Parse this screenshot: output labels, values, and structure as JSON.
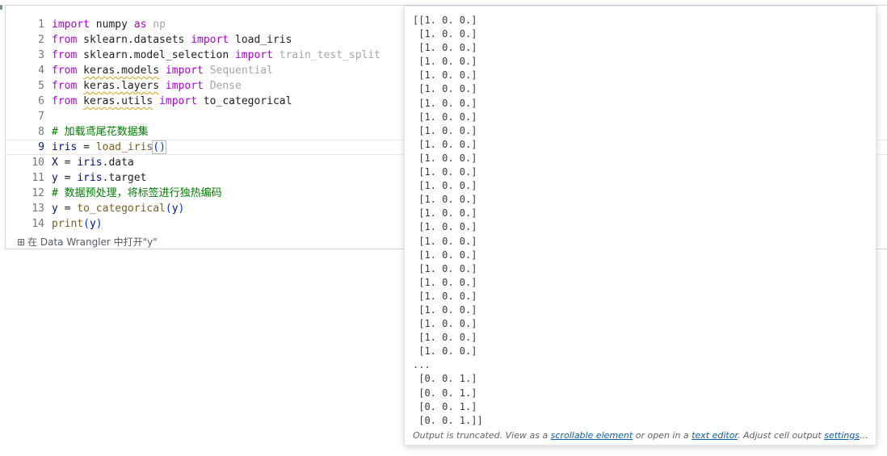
{
  "editor": {
    "lines": [
      {
        "n": "1",
        "parts": [
          {
            "t": "import",
            "c": "kw"
          },
          {
            "t": " numpy ",
            "c": ""
          },
          {
            "t": "as",
            "c": "kw"
          },
          {
            "t": " ",
            "c": ""
          },
          {
            "t": "np",
            "c": "dim"
          }
        ]
      },
      {
        "n": "2",
        "parts": [
          {
            "t": "from",
            "c": "kw"
          },
          {
            "t": " sklearn.datasets ",
            "c": ""
          },
          {
            "t": "import",
            "c": "kw"
          },
          {
            "t": " load_iris",
            "c": ""
          }
        ]
      },
      {
        "n": "3",
        "parts": [
          {
            "t": "from",
            "c": "kw"
          },
          {
            "t": " sklearn.model_selection ",
            "c": ""
          },
          {
            "t": "import",
            "c": "kw"
          },
          {
            "t": " ",
            "c": ""
          },
          {
            "t": "train_test_split",
            "c": "dim"
          }
        ]
      },
      {
        "n": "4",
        "parts": [
          {
            "t": "from",
            "c": "kw"
          },
          {
            "t": " ",
            "c": ""
          },
          {
            "t": "keras.models",
            "c": "sq"
          },
          {
            "t": " ",
            "c": ""
          },
          {
            "t": "import",
            "c": "kw"
          },
          {
            "t": " ",
            "c": ""
          },
          {
            "t": "Sequential",
            "c": "dim"
          }
        ]
      },
      {
        "n": "5",
        "parts": [
          {
            "t": "from",
            "c": "kw"
          },
          {
            "t": " ",
            "c": ""
          },
          {
            "t": "keras.layers",
            "c": "sq"
          },
          {
            "t": " ",
            "c": ""
          },
          {
            "t": "import",
            "c": "kw"
          },
          {
            "t": " ",
            "c": ""
          },
          {
            "t": "Dense",
            "c": "dim"
          }
        ]
      },
      {
        "n": "6",
        "parts": [
          {
            "t": "from",
            "c": "kw"
          },
          {
            "t": " ",
            "c": ""
          },
          {
            "t": "keras.utils",
            "c": "sq"
          },
          {
            "t": " ",
            "c": ""
          },
          {
            "t": "import",
            "c": "kw"
          },
          {
            "t": " to_categorical",
            "c": ""
          }
        ]
      },
      {
        "n": "7",
        "parts": []
      },
      {
        "n": "8",
        "parts": [
          {
            "t": "# 加载鸢尾花数据集",
            "c": "cm"
          }
        ]
      },
      {
        "n": "9",
        "current": true,
        "parts": [
          {
            "t": "iris",
            "c": "var"
          },
          {
            "t": " = ",
            "c": ""
          },
          {
            "t": "load_iris",
            "c": "fn"
          },
          {
            "t": "()",
            "c": "paren-box"
          }
        ]
      },
      {
        "n": "10",
        "parts": [
          {
            "t": "X",
            "c": "var"
          },
          {
            "t": " = ",
            "c": ""
          },
          {
            "t": "iris",
            "c": "var"
          },
          {
            "t": ".data",
            "c": ""
          }
        ]
      },
      {
        "n": "11",
        "parts": [
          {
            "t": "y",
            "c": "var"
          },
          {
            "t": " = ",
            "c": ""
          },
          {
            "t": "iris",
            "c": "var"
          },
          {
            "t": ".target",
            "c": ""
          }
        ]
      },
      {
        "n": "12",
        "parts": [
          {
            "t": "# 数据预处理，将标签进行独热编码",
            "c": "cm"
          }
        ]
      },
      {
        "n": "13",
        "parts": [
          {
            "t": "y",
            "c": "var"
          },
          {
            "t": " = ",
            "c": ""
          },
          {
            "t": "to_categorical",
            "c": "fn"
          },
          {
            "t": "(",
            "c": "paren"
          },
          {
            "t": "y",
            "c": "var"
          },
          {
            "t": ")",
            "c": "paren"
          }
        ]
      },
      {
        "n": "14",
        "parts": [
          {
            "t": "print",
            "c": "fn"
          },
          {
            "t": "(",
            "c": "paren"
          },
          {
            "t": "y",
            "c": "var"
          },
          {
            "t": ")",
            "c": "paren"
          }
        ]
      }
    ],
    "wrangler_icon": "table-icon",
    "wrangler_text": "在 Data Wrangler 中打开\"y\""
  },
  "output": {
    "lines": [
      "[[1. 0. 0.]",
      " [1. 0. 0.]",
      " [1. 0. 0.]",
      " [1. 0. 0.]",
      " [1. 0. 0.]",
      " [1. 0. 0.]",
      " [1. 0. 0.]",
      " [1. 0. 0.]",
      " [1. 0. 0.]",
      " [1. 0. 0.]",
      " [1. 0. 0.]",
      " [1. 0. 0.]",
      " [1. 0. 0.]",
      " [1. 0. 0.]",
      " [1. 0. 0.]",
      " [1. 0. 0.]",
      " [1. 0. 0.]",
      " [1. 0. 0.]",
      " [1. 0. 0.]",
      " [1. 0. 0.]",
      " [1. 0. 0.]",
      " [1. 0. 0.]",
      " [1. 0. 0.]",
      " [1. 0. 0.]",
      " [1. 0. 0.]",
      "...",
      " [0. 0. 1.]",
      " [0. 0. 1.]",
      " [0. 0. 1.]",
      " [0. 0. 1.]]"
    ],
    "footer": {
      "prefix": "Output is truncated. View as a ",
      "link1": "scrollable element",
      "mid": " or open in a ",
      "link2": "text editor",
      "mid2": ". Adjust cell output ",
      "link3": "settings",
      "suffix": "..."
    }
  }
}
